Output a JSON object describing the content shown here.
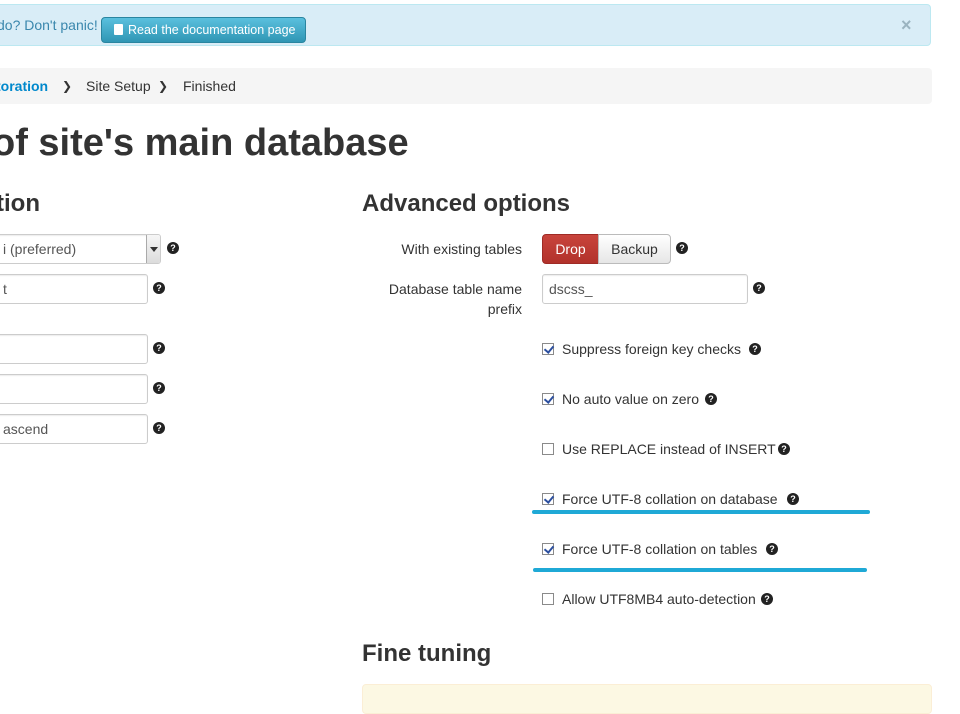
{
  "alert": {
    "text": "do? Don't panic!",
    "doc_button": "Read the documentation page",
    "close": "×"
  },
  "breadcrumb": {
    "items": [
      "toration",
      "Site Setup",
      "Finished"
    ],
    "separator": "❯"
  },
  "page_title": "of site's main database",
  "left_section": {
    "heading": "tion",
    "driver_select": "i (preferred)",
    "host_value": "t",
    "username_value": "",
    "password_value": "",
    "database_value": "ascend"
  },
  "advanced": {
    "heading": "Advanced options",
    "existing_tables_label": "With existing tables",
    "drop_label": "Drop",
    "backup_label": "Backup",
    "prefix_label": "Database table name prefix",
    "prefix_value": "dscss_",
    "options": [
      {
        "label": "Suppress foreign key checks",
        "checked": true
      },
      {
        "label": "No auto value on zero",
        "checked": true
      },
      {
        "label": "Use REPLACE instead of INSERT",
        "checked": false
      },
      {
        "label": "Force UTF-8 collation on database",
        "checked": true
      },
      {
        "label": "Force UTF-8 collation on tables",
        "checked": true
      },
      {
        "label": "Allow UTF8MB4 auto-detection",
        "checked": false
      }
    ]
  },
  "fine_tuning": {
    "heading": "Fine tuning"
  },
  "help_glyph": "?",
  "colors": {
    "alert_bg": "#d9edf7",
    "info_button": "#2f96b4",
    "drop_button": "#b2322b",
    "active_crumb": "#0088cc",
    "highlight_underline": "#1fa9d6",
    "warning_bg": "#fcf8e3"
  }
}
